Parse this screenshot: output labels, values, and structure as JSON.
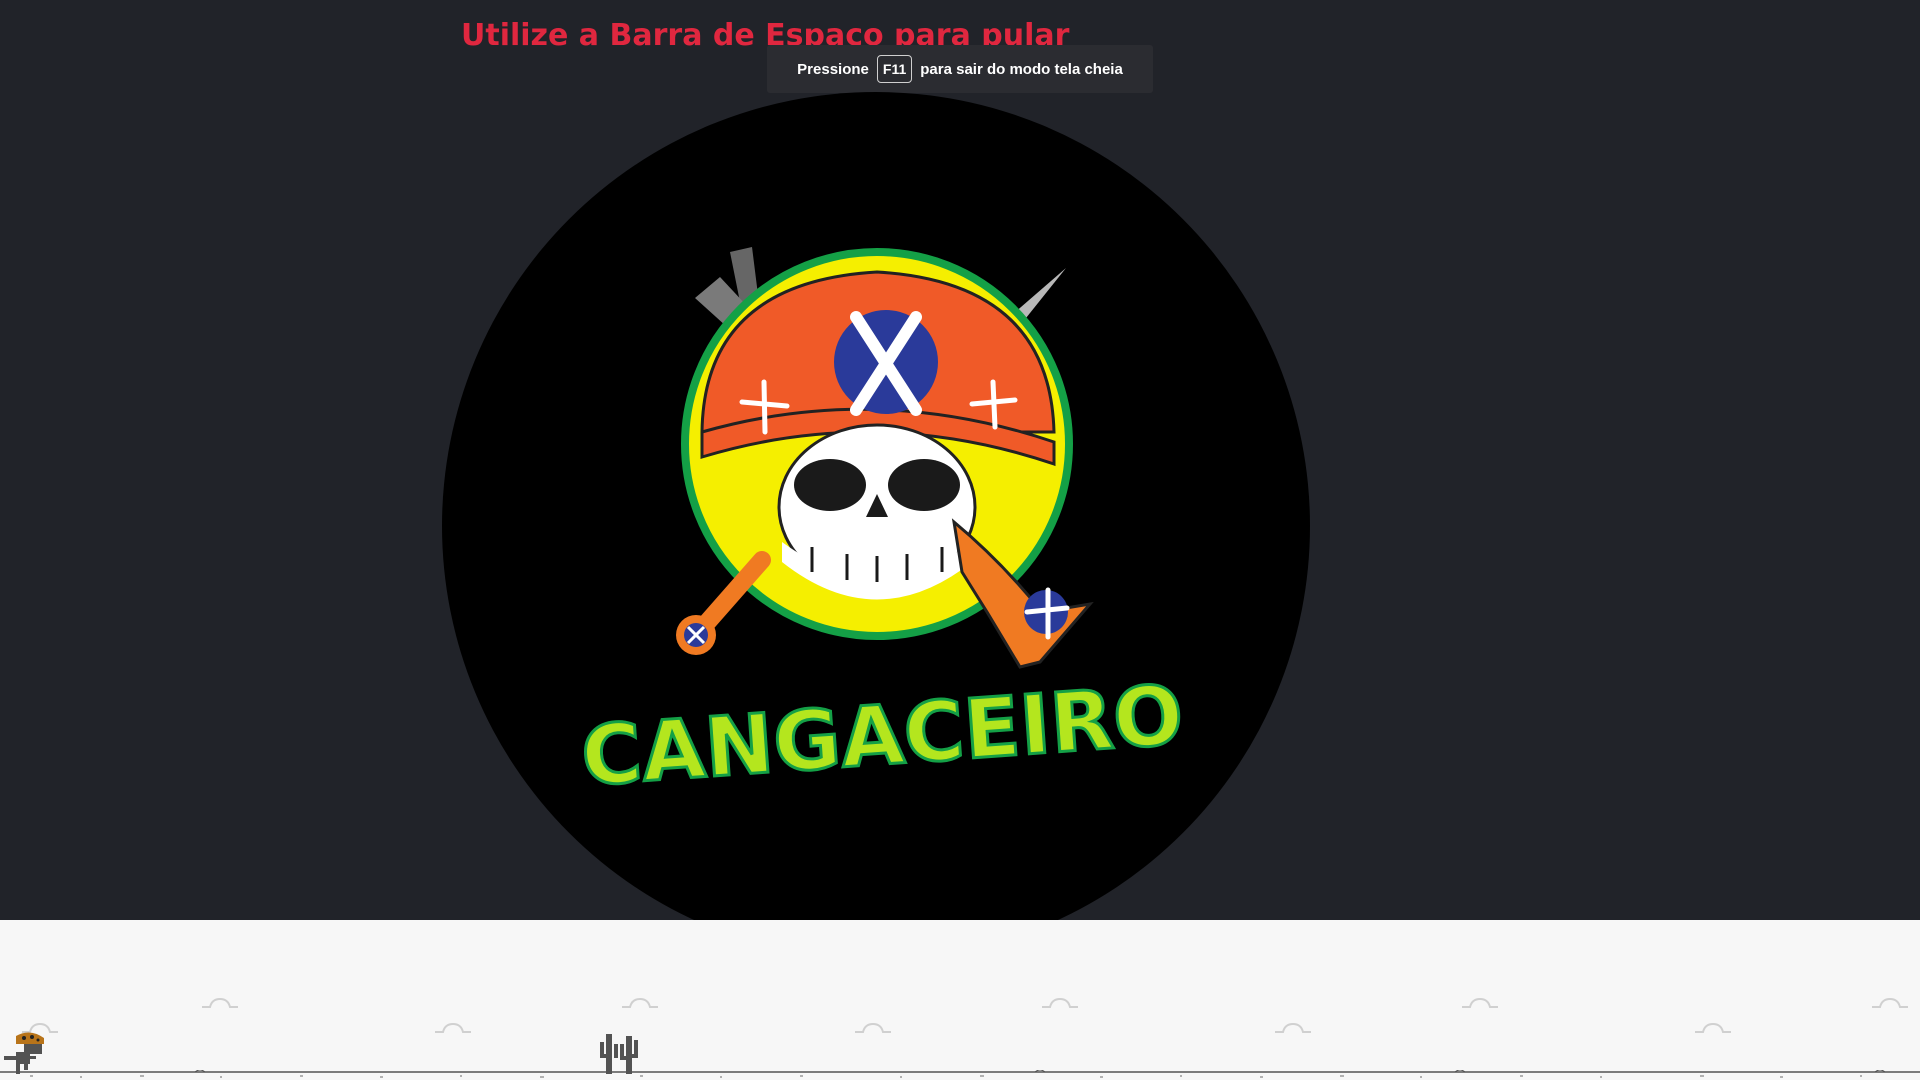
{
  "instruction": "Utilize a Barra de Espaço para pular",
  "fullscreen_notice": {
    "prefix": "Pressione",
    "key": "F11",
    "suffix": "para sair do modo tela cheia"
  },
  "logo": {
    "text": "CANGACEIRO",
    "icon": "cangaceiro-skull-logo"
  },
  "game": {
    "player_icon": "dino-with-cangaceiro-hat-icon",
    "obstacle_icon": "cactus-icon"
  },
  "colors": {
    "background": "#212329",
    "instruction_text": "#e0273f",
    "game_area": "#f7f7f7",
    "logo_text": "#b4e61e",
    "logo_ring": "#14a046"
  }
}
